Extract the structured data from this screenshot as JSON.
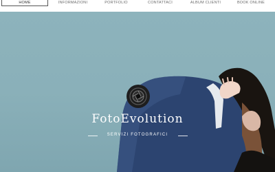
{
  "nav": {
    "items": [
      {
        "label": "HOME",
        "active": true
      },
      {
        "label": "INFORMAZIONI",
        "active": false
      },
      {
        "label": "PORTFOLIO",
        "active": false
      },
      {
        "label": "CONTATTACI",
        "active": false
      },
      {
        "label": "ALBUM CLIENTI",
        "active": false
      },
      {
        "label": "BOOK ONLINE",
        "active": false
      }
    ]
  },
  "hero": {
    "brand": "FotoEvolution",
    "tagline": "SERVIZI FOTOGRAFICI",
    "logo_icon": "camera-aperture-icon"
  },
  "colors": {
    "sky": "#8db3bc",
    "suit": "#2c4470",
    "nav_text": "#6a6a6a"
  }
}
